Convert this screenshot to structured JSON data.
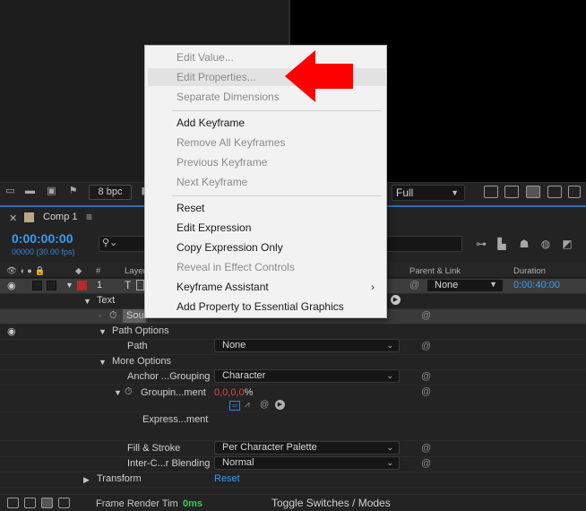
{
  "viewer": {
    "bpc": "8 bpc",
    "resolution": "Full"
  },
  "comp": {
    "tab_label": "Comp 1",
    "timecode": "0:00:00:00",
    "timecode_sub": "00000 (30.00 fps)",
    "columns": {
      "num": "#",
      "layer": "Layer",
      "parent": "Parent & Link",
      "duration": "Duration"
    },
    "layer": {
      "number": "1",
      "type_glyph": "T",
      "parent": "None",
      "duration": "0:00:40:00"
    },
    "rows": {
      "text": "Text",
      "source_text": "Sour",
      "path_options": "Path Options",
      "path": "Path",
      "path_value": "None",
      "more_options": "More Options",
      "anchor_grouping": "Anchor ...Grouping",
      "anchor_grouping_value": "Character",
      "grouping_alignment": "Groupin...ment",
      "grouping_value_a": "0,0",
      "grouping_value_sep": ",",
      "grouping_value_b": "0,0",
      "grouping_unit": "%",
      "expression_label": "Express...ment",
      "fill_stroke": "Fill & Stroke",
      "fill_stroke_value": "Per Character Palette",
      "inter_char_blending": "Inter-C...r Blending",
      "inter_char_value": "Normal",
      "transform": "Transform",
      "reset": "Reset"
    },
    "bottom": {
      "frame_render_label": "Frame Render Tim",
      "frame_render_value": "0ms",
      "toggle": "Toggle Switches / Modes"
    }
  },
  "context_menu": {
    "items": [
      {
        "label": "Edit Value...",
        "disabled": true
      },
      {
        "label": "Edit Properties...",
        "disabled": true,
        "hovered": true
      },
      {
        "label": "Separate Dimensions",
        "disabled": true
      },
      {
        "label": "Add Keyframe",
        "disabled": false
      },
      {
        "label": "Remove All Keyframes",
        "disabled": true
      },
      {
        "label": "Previous Keyframe",
        "disabled": true
      },
      {
        "label": "Next Keyframe",
        "disabled": true
      },
      {
        "label": "Reset",
        "disabled": false
      },
      {
        "label": "Edit Expression",
        "disabled": false
      },
      {
        "label": "Copy Expression Only",
        "disabled": false
      },
      {
        "label": "Reveal in Effect Controls",
        "disabled": true
      },
      {
        "label": "Keyframe Assistant",
        "disabled": false,
        "submenu": true
      },
      {
        "label": "Add Property to Essential Graphics",
        "disabled": false
      }
    ]
  },
  "colors": {
    "accent_blue": "#3b9cf0",
    "red_arrow": "#ff0000",
    "layer_label": "#b72a2a",
    "render_green": "#3fc45c"
  },
  "icons": [
    "stopwatch-icon",
    "eye-icon",
    "spiral-pickwhip-icon",
    "search-icon",
    "chevron-down-icon",
    "chevron-right-icon",
    "red-arrow-icon"
  ]
}
